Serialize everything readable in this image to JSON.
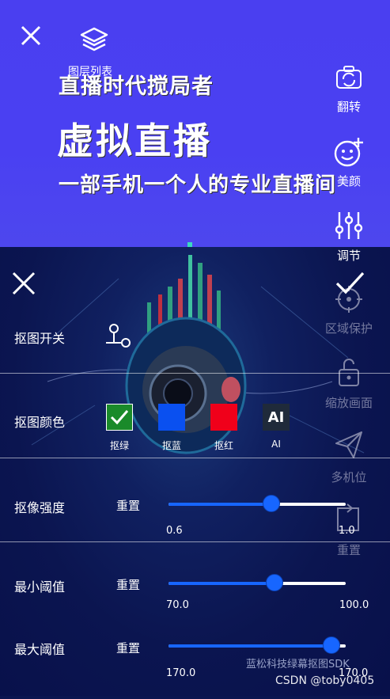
{
  "top": {
    "layers_label": "图层列表",
    "headline1": "直播时代搅局者",
    "headline2": "虚拟直播",
    "headline3": "一部手机一个人的专业直播间"
  },
  "side": {
    "items": [
      {
        "label": "翻转",
        "icon": "camera-flip-icon"
      },
      {
        "label": "美颜",
        "icon": "face-plus-icon"
      },
      {
        "label": "调节",
        "icon": "sliders-icon"
      },
      {
        "label": "区域保护",
        "icon": "target-icon"
      },
      {
        "label": "缩放画面",
        "icon": "unlock-icon"
      },
      {
        "label": "多机位",
        "icon": "send-icon"
      },
      {
        "label": "重置",
        "icon": "reset-icon"
      }
    ]
  },
  "panel": {
    "matting_switch_label": "抠图开关",
    "matting_color_label": "抠图颜色",
    "colors": [
      {
        "label": "抠绿",
        "color": "#1a8a2a"
      },
      {
        "label": "抠蓝",
        "color": "#0a50f0"
      },
      {
        "label": "抠红",
        "color": "#f0001a"
      },
      {
        "label": "AI",
        "color": "#1f2a3a",
        "text": "AI"
      }
    ],
    "sliders": [
      {
        "label": "抠像强度",
        "reset": "重置",
        "min": "0.6",
        "max": "1.0",
        "fraction": 0.58
      },
      {
        "label": "最小阈值",
        "reset": "重置",
        "min": "70.0",
        "max": "100.0",
        "fraction": 0.6
      },
      {
        "label": "最大阈值",
        "reset": "重置",
        "min": "170.0",
        "max": "170.0",
        "fraction": 0.92
      }
    ]
  },
  "watermark": "蓝松科技绿幕抠图SDK",
  "credit": "CSDN @toby0405"
}
